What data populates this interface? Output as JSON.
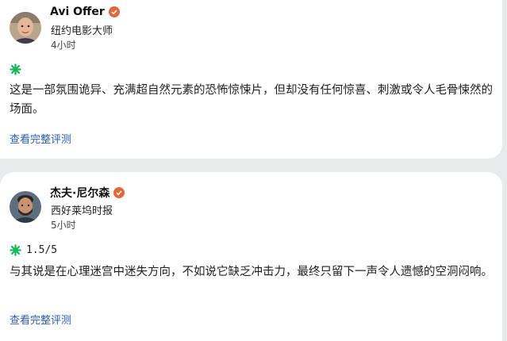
{
  "reviews": [
    {
      "author": "Avi Offer",
      "outlet": "纽约电影大师",
      "time": "4小时",
      "rating": "",
      "text": "这是一部氛围诡异、充满超自然元素的恐怖惊悚片，但却没有任何惊喜、刺激或令人毛骨悚然的场面。",
      "link": "查看完整评测",
      "avatar_icon": "person-avatar-icon"
    },
    {
      "author": "杰夫·尼尔森",
      "outlet": "西好莱坞时报",
      "time": "5小时",
      "rating": "1.5/5",
      "text": "与其说是在心理迷宫中迷失方向，不如说它缺乏冲击力，最终只留下一声令人遗憾的空洞闷响。",
      "link": "查看完整评测",
      "avatar_icon": "person-avatar-icon"
    }
  ],
  "colors": {
    "splat_green": "#18b85a",
    "verified_orange": "#e2673a",
    "link_blue": "#2a5db0"
  }
}
